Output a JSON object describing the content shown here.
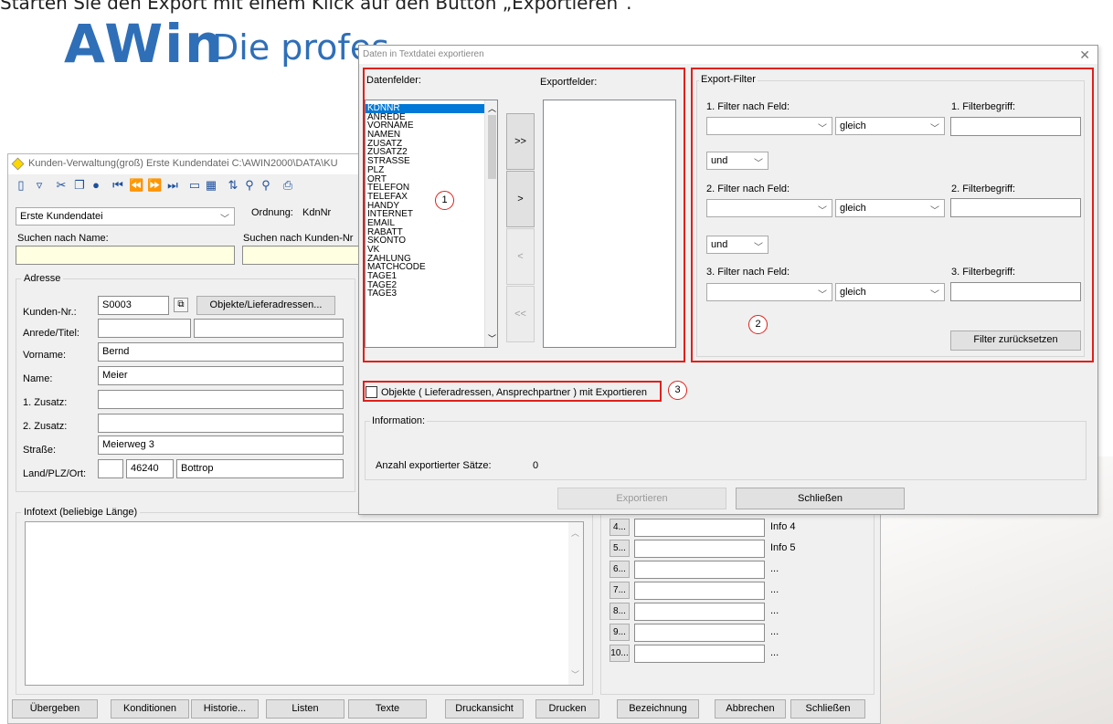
{
  "caption": "Starten Sie den Export mit einem Klick auf den Button „Exportieren“.",
  "logo": {
    "mark": "AWin",
    "sub": "Die profes"
  },
  "main_window": {
    "title": "Kunden-Verwaltung(groß)   Erste Kundendatei   C:\\AWIN2000\\DATA\\KU",
    "file_combo": "Erste Kundendatei",
    "ordnung_label": "Ordnung:",
    "ordnung_value": "KdnNr",
    "search_name_label": "Suchen nach Name:",
    "search_nr_label": "Suchen nach Kunden-Nr",
    "address_group": "Adresse",
    "fields": {
      "kundennr_label": "Kunden-Nr.:",
      "kundennr_value": "S0003",
      "objekte_button": "Objekte/Lieferadressen...",
      "anrede_label": "Anrede/Titel:",
      "vorname_label": "Vorname:",
      "vorname_value": "Bernd",
      "name_label": "Name:",
      "name_value": "Meier",
      "zusatz1_label": "1. Zusatz:",
      "zusatz2_label": "2. Zusatz:",
      "strasse_label": "Straße:",
      "strasse_value": "Meierweg 3",
      "landplzort_label": "Land/PLZ/Ort:",
      "plz_value": "46240",
      "ort_value": "Bottrop"
    },
    "infotext_label": "Infotext (beliebige Länge)",
    "info_rows": [
      {
        "btn": "4...",
        "label": "Info 4"
      },
      {
        "btn": "5...",
        "label": "Info 5"
      },
      {
        "btn": "6...",
        "label": "..."
      },
      {
        "btn": "7...",
        "label": "..."
      },
      {
        "btn": "8...",
        "label": "..."
      },
      {
        "btn": "9...",
        "label": "..."
      },
      {
        "btn": "10...",
        "label": "..."
      }
    ],
    "bottom_buttons": [
      "Übergeben",
      "Konditionen",
      "Historie...",
      "Listen",
      "Texte",
      "Druckansicht",
      "Drucken",
      "Bezeichnung",
      "Abbrechen",
      "Schließen"
    ]
  },
  "dialog": {
    "title": "Daten in Textdatei exportieren",
    "datenfelder_label": "Datenfelder:",
    "exportfelder_label": "Exportfelder:",
    "datenfelder": [
      "KDNNR",
      "ANREDE",
      "VORNAME",
      "NAMEN",
      "ZUSATZ",
      "ZUSATZ2",
      "STRASSE",
      "PLZ",
      "ORT",
      "TELEFON",
      "TELEFAX",
      "HANDY",
      "INTERNET",
      "EMAIL",
      "RABATT",
      "SKONTO",
      "VK",
      "ZAHLUNG",
      "MATCHCODE",
      "TAGE1",
      "TAGE2",
      "TAGE3"
    ],
    "move_buttons": [
      ">>",
      ">",
      "<",
      "<<"
    ],
    "export_filter_label": "Export-Filter",
    "filter1_field_label": "1. Filter nach Feld:",
    "filter1_term_label": "1. Filterbegriff:",
    "filter2_field_label": "2. Filter nach Feld:",
    "filter2_term_label": "2. Filterbegriff:",
    "filter3_field_label": "3. Filter nach Feld:",
    "filter3_term_label": "3. Filterbegriff:",
    "operator": "gleich",
    "logic1": "und",
    "logic2": "und",
    "reset_button": "Filter zurücksetzen",
    "objects_checkbox_label": "Objekte ( Lieferadressen, Ansprechpartner ) mit Exportieren",
    "information_label": "Information:",
    "count_label": "Anzahl exportierter Sätze:",
    "count_value": "0",
    "export_button": "Exportieren",
    "close_button": "Schließen",
    "markers": [
      "1",
      "2",
      "3"
    ]
  }
}
